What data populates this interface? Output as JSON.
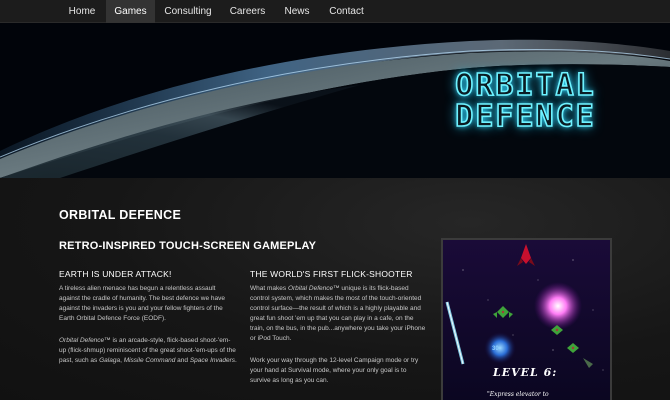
{
  "nav": {
    "items": [
      {
        "label": "Home"
      },
      {
        "label": "Games"
      },
      {
        "label": "Consulting"
      },
      {
        "label": "Careers"
      },
      {
        "label": "News"
      },
      {
        "label": "Contact"
      }
    ],
    "active": "Games"
  },
  "hero": {
    "logo_line1": "ORBITAL",
    "logo_line2": "DEFENCE",
    "logo_color": "#6ff2ff"
  },
  "main": {
    "title": "ORBITAL DEFENCE",
    "subtitle": "RETRO-INSPIRED TOUCH-SCREEN GAMEPLAY",
    "left_column": {
      "heading": "EARTH IS UNDER ATTACK!",
      "para1": "A tireless alien menace has begun a relentless assault against the cradle of humanity. The best defence we have against the invaders is you and your fellow fighters of the Earth Orbital Defence Force (EODF).",
      "para2_game": "Orbital Defence™",
      "para2_text1": " is an arcade-style, flick-based shoot-'em-up (flick-shmup) reminiscent of the great shoot-'em-ups of the past, such as ",
      "para2_ref1": "Galaga",
      "para2_sep": ", ",
      "para2_ref2": "Missile Command",
      "para2_and": " and ",
      "para2_ref3": "Space Invaders",
      "para2_end": "."
    },
    "right_column": {
      "heading": "THE WORLD'S FIRST FLICK-SHOOTER",
      "para1_start": "What makes ",
      "para1_game": "Orbital Defence™",
      "para1_text": " unique is its flick-based control system, which makes the most of the touch-oriented control surface—the result of which is a highly playable and great fun shoot 'em up that you can play in a cafe, on the train, on the bus, in the pub...anywhere you take your iPhone or iPod Touch.",
      "para2": "Work your way through the 12-level Campaign mode or try your hand at Survival mode, where your only goal is to survive as long as you can."
    }
  },
  "screenshot": {
    "score": "30",
    "level": "LEVEL 6:",
    "quote": "\"Express elevator to"
  }
}
